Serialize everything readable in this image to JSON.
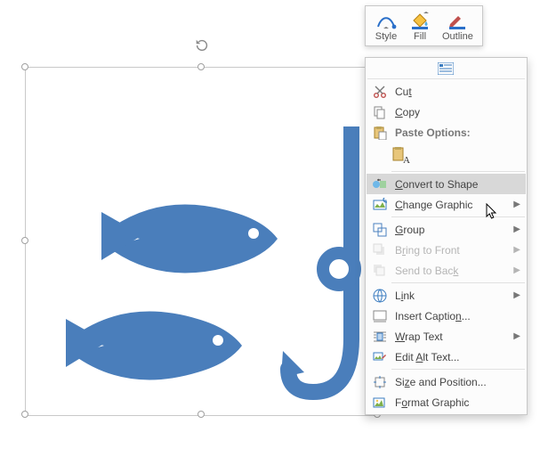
{
  "selection": {
    "kind": "graphic-icon",
    "description": "Fish and hook icon",
    "color": "#4a7ebb"
  },
  "mini_toolbar": {
    "style_label": "Style",
    "fill_label": "Fill",
    "outline_label": "Outline"
  },
  "context_menu": {
    "cut": "Cut",
    "copy": "Copy",
    "paste_options": "Paste Options:",
    "paste_keep_text": "Keep Text Only (paste option)",
    "convert_to_shape": "Convert to Shape",
    "change_graphic": "Change Graphic",
    "group": "Group",
    "bring_to_front": "Bring to Front",
    "send_to_back": "Send to Back",
    "link": "Link",
    "insert_caption": "Insert Caption...",
    "wrap_text": "Wrap Text",
    "edit_alt_text": "Edit Alt Text...",
    "size_position": "Size and Position...",
    "format_graphic": "Format Graphic"
  },
  "context_menu_access_keys": {
    "cut": "t",
    "copy": "C",
    "convert_to_shape": "C",
    "change_graphic": "C",
    "group": "G",
    "bring_to_front": "R",
    "send_to_back": "K",
    "link": "I",
    "insert_caption": "N",
    "wrap_text": "W",
    "edit_alt_text": "A",
    "size_position": "Z",
    "format_graphic": "O"
  },
  "context_menu_state": {
    "highlighted": "convert_to_shape",
    "disabled": [
      "bring_to_front",
      "send_to_back"
    ]
  },
  "icons": {
    "rotate": "rotate-handle-icon",
    "style": "style-icon",
    "fill": "fill-bucket-icon",
    "outline": "outline-pen-icon",
    "cut": "scissors-icon",
    "copy": "copy-icon",
    "paste": "paste-icon",
    "keep_text": "keep-text-icon",
    "convert_to_shape": "convert-to-shape-icon",
    "change_graphic": "change-graphic-icon",
    "group": "group-icon",
    "bring_to_front": "bring-to-front-icon",
    "send_to_back": "send-to-back-icon",
    "link": "link-icon",
    "insert_caption": "insert-caption-icon",
    "wrap_text": "wrap-text-icon",
    "edit_alt_text": "alt-text-icon",
    "size_position": "size-position-icon",
    "format_graphic": "format-graphic-icon"
  }
}
